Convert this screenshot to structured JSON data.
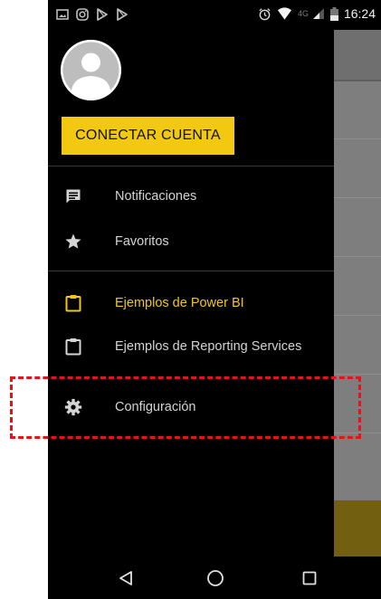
{
  "status_bar": {
    "left_icons": [
      "image-icon",
      "instagram-icon",
      "play-store-icon",
      "play-store-icon"
    ],
    "right_icons": [
      "alarm-icon",
      "wifi-icon",
      "signal-icon",
      "battery-icon"
    ],
    "network_label": "4G",
    "time": "16:24"
  },
  "drawer": {
    "avatar_icon": "user-avatar-icon",
    "connect_button_label": "CONECTAR CUENTA",
    "items": [
      {
        "label": "Notificaciones",
        "icon": "notification-icon",
        "active": false
      },
      {
        "label": "Favoritos",
        "icon": "star-icon",
        "active": false
      },
      {
        "label": "Ejemplos de Power BI",
        "icon": "clipboard-icon",
        "active": true
      },
      {
        "label": "Ejemplos de Reporting Services",
        "icon": "clipboard-icon",
        "active": false
      },
      {
        "label": "Configuración",
        "icon": "gear-icon",
        "active": false
      }
    ]
  },
  "navigation_bar": {
    "buttons": [
      "back-icon",
      "home-icon",
      "recents-icon"
    ]
  },
  "colors": {
    "accent": "#f2c811",
    "drawer_background": "#000000",
    "highlight": "#e3141b",
    "inactive_text": "#d4d4d4"
  }
}
